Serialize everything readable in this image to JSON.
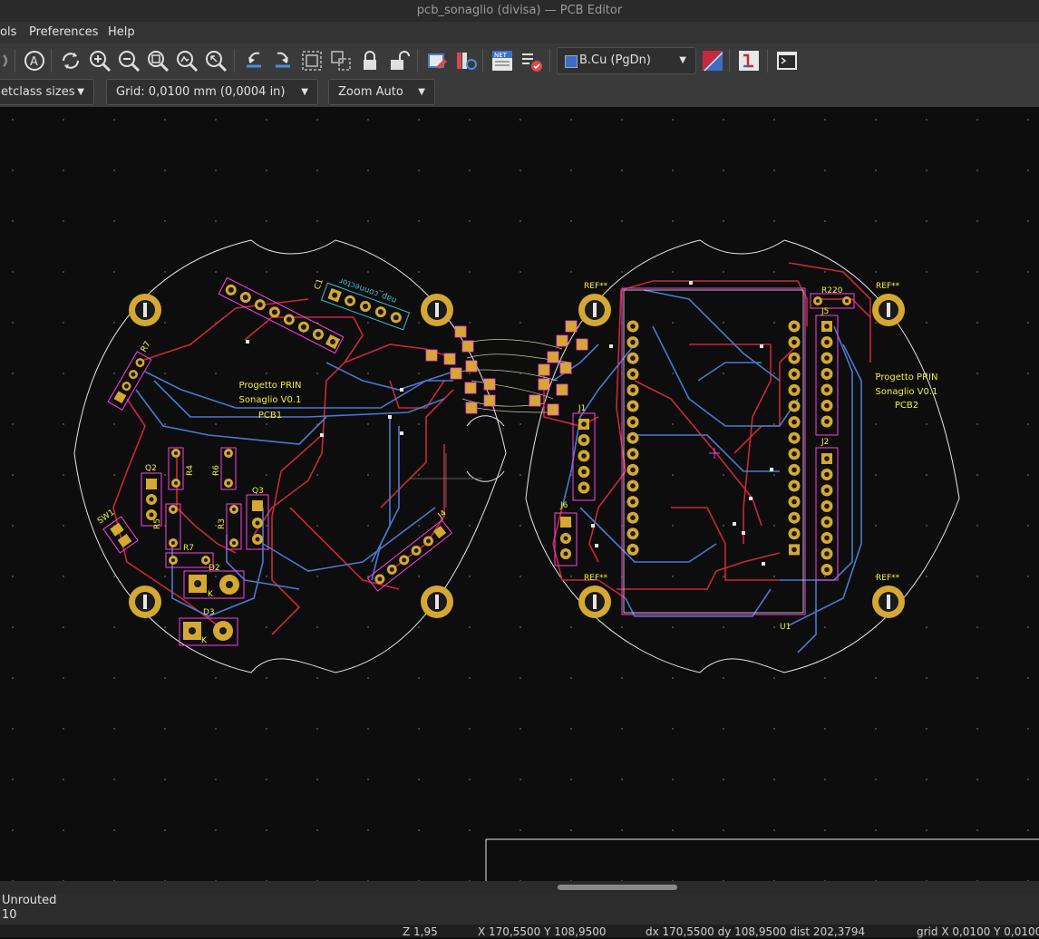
{
  "window": {
    "title": "pcb_sonaglio (divisa) — PCB Editor"
  },
  "menu": {
    "items": [
      "ols",
      "Preferences",
      "Help"
    ]
  },
  "toolbar": {
    "layer_select": {
      "value": "B.Cu (PgDn)",
      "color": "#3d6cc6"
    }
  },
  "auxbar": {
    "track_width": "etclass sizes",
    "grid": "Grid: 0,0100 mm (0,0004 in)",
    "zoom": "Zoom Auto"
  },
  "board": {
    "pcb1": {
      "title_l1": "Progetto PRIN",
      "title_l2": "Sonaglio V0.1",
      "ref": "PCB1"
    },
    "pcb2": {
      "title_l1": "Progetto PRIN",
      "title_l2": "Sonaglio V0.1",
      "ref": "PCB2"
    },
    "connector_text": "nap_connector",
    "refs": {
      "r7_top": "R7",
      "q2": "Q2",
      "r4": "R4",
      "r6": "R6",
      "q3": "Q3",
      "sw1": "SW1",
      "r3": "R3",
      "r5": "R5",
      "r7": "R7",
      "d2": "D2",
      "d3": "D3",
      "k1": "K",
      "k2": "K",
      "j4": "J4",
      "j1": "J1",
      "j6": "J6",
      "j5": "J5",
      "j2": "J2",
      "r220": "R220",
      "u1": "U1",
      "ref1": "REF**",
      "ref2": "REF**",
      "ref3": "REF**",
      "ref4": "REF**",
      "c1": "C1"
    },
    "colors": {
      "front_copper": "#c8283c",
      "back_copper": "#4a7ad0",
      "edge": "#e6e6e6",
      "pad": "#d4a832",
      "silk": "#f2f23a",
      "courtyard": "#ff3ee6"
    }
  },
  "messages": {
    "line1": "Unrouted",
    "line2": "10"
  },
  "status": {
    "z": "Z 1,95",
    "xy": "X 170,5500  Y 108,9500",
    "delta": "dx 170,5500  dy 108,9500  dist 202,3794",
    "grid": "grid X 0,0100  Y 0,0100"
  }
}
